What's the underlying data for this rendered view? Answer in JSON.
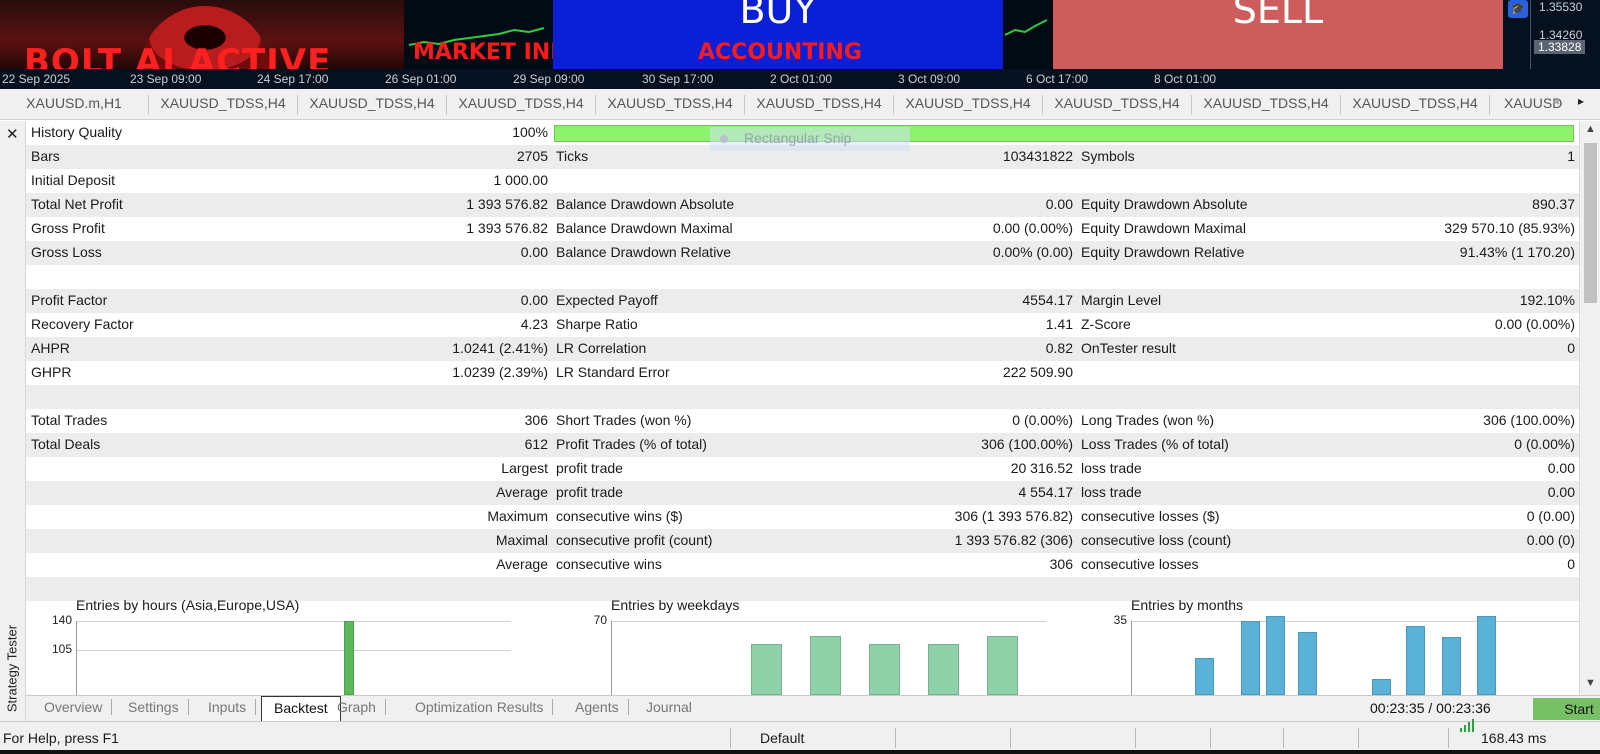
{
  "chart": {
    "banner_text": "BOLT AI ACTIVE",
    "market_info": "MARKET INFO",
    "accounting": "ACCOUNTING",
    "buy_label": "BUY",
    "sell_label": "SELL",
    "prices": [
      "1.35530",
      "1.34260"
    ],
    "current_price": "1.33828",
    "time_labels": [
      "22 Sep 2025",
      "23 Sep 09:00",
      "24 Sep 17:00",
      "26 Sep 01:00",
      "29 Sep 09:00",
      "30 Sep 17:00",
      "2 Oct 01:00",
      "3 Oct 09:00",
      "6 Oct 17:00",
      "8 Oct 01:00"
    ]
  },
  "symbol_tabs": [
    "XAUUSD.m,H1",
    "XAUUSD_TDSS,H4",
    "XAUUSD_TDSS,H4",
    "XAUUSD_TDSS,H4",
    "XAUUSD_TDSS,H4",
    "XAUUSD_TDSS,H4",
    "XAUUSD_TDSS,H4",
    "XAUUSD_TDSS,H4",
    "XAUUSD_TDSS,H4",
    "XAUUSD_TDSS,H4",
    "XAUUSD"
  ],
  "tester": {
    "side_label": "Strategy Tester",
    "history_quality": {
      "label": "History Quality",
      "value": "100%",
      "percent": 100
    },
    "rows": [
      [
        {
          "label": "Bars",
          "value": "2705"
        },
        {
          "label": "Ticks",
          "value": "103431822"
        },
        {
          "label": "Symbols",
          "value": "1"
        }
      ],
      [
        {
          "label": "Initial Deposit",
          "value": "1 000.00"
        },
        {
          "label": "",
          "value": ""
        },
        {
          "label": "",
          "value": ""
        }
      ],
      [
        {
          "label": "Total Net Profit",
          "value": "1 393 576.82"
        },
        {
          "label": "Balance Drawdown Absolute",
          "value": "0.00"
        },
        {
          "label": "Equity Drawdown Absolute",
          "value": "890.37"
        }
      ],
      [
        {
          "label": "Gross Profit",
          "value": "1 393 576.82"
        },
        {
          "label": "Balance Drawdown Maximal",
          "value": "0.00 (0.00%)"
        },
        {
          "label": "Equity Drawdown Maximal",
          "value": "329 570.10 (85.93%)"
        }
      ],
      [
        {
          "label": "Gross Loss",
          "value": "0.00"
        },
        {
          "label": "Balance Drawdown Relative",
          "value": "0.00% (0.00)"
        },
        {
          "label": "Equity Drawdown Relative",
          "value": "91.43% (1 170.20)"
        }
      ],
      [
        {
          "label": "",
          "value": ""
        },
        {
          "label": "",
          "value": ""
        },
        {
          "label": "",
          "value": ""
        }
      ],
      [
        {
          "label": "Profit Factor",
          "value": "0.00"
        },
        {
          "label": "Expected Payoff",
          "value": "4554.17"
        },
        {
          "label": "Margin Level",
          "value": "192.10%"
        }
      ],
      [
        {
          "label": "Recovery Factor",
          "value": "4.23"
        },
        {
          "label": "Sharpe Ratio",
          "value": "1.41"
        },
        {
          "label": "Z-Score",
          "value": "0.00 (0.00%)"
        }
      ],
      [
        {
          "label": "AHPR",
          "value": "1.0241 (2.41%)"
        },
        {
          "label": "LR Correlation",
          "value": "0.82"
        },
        {
          "label": "OnTester result",
          "value": "0"
        }
      ],
      [
        {
          "label": "GHPR",
          "value": "1.0239 (2.39%)"
        },
        {
          "label": "LR Standard Error",
          "value": "222 509.90"
        },
        {
          "label": "",
          "value": ""
        }
      ],
      [
        {
          "label": "",
          "value": ""
        },
        {
          "label": "",
          "value": ""
        },
        {
          "label": "",
          "value": ""
        }
      ],
      [
        {
          "label": "Total Trades",
          "value": "306"
        },
        {
          "label": "Short Trades (won %)",
          "value": "0 (0.00%)"
        },
        {
          "label": "Long Trades (won %)",
          "value": "306 (100.00%)"
        }
      ],
      [
        {
          "label": "Total Deals",
          "value": "612"
        },
        {
          "label": "Profit Trades (% of total)",
          "value": "306 (100.00%)"
        },
        {
          "label": "Loss Trades (% of total)",
          "value": "0 (0.00%)"
        }
      ]
    ],
    "trade_rows": [
      {
        "prefix": "Largest",
        "mid_label": "profit trade",
        "mid_value": "20 316.52",
        "right_label": "loss trade",
        "right_value": "0.00"
      },
      {
        "prefix": "Average",
        "mid_label": "profit trade",
        "mid_value": "4 554.17",
        "right_label": "loss trade",
        "right_value": "0.00"
      },
      {
        "prefix": "Maximum",
        "mid_label": "consecutive wins ($)",
        "mid_value": "306 (1 393 576.82)",
        "right_label": "consecutive losses ($)",
        "right_value": "0 (0.00)"
      },
      {
        "prefix": "Maximal",
        "mid_label": "consecutive profit (count)",
        "mid_value": "1 393 576.82 (306)",
        "right_label": "consecutive loss (count)",
        "right_value": "0.00 (0)"
      },
      {
        "prefix": "Average",
        "mid_label": "consecutive wins",
        "mid_value": "306",
        "right_label": "consecutive losses",
        "right_value": "0"
      }
    ],
    "snip_overlay": "Rectangular Snip"
  },
  "chart_data": [
    {
      "type": "bar",
      "title": "Entries by hours (Asia,Europe,USA)",
      "y_ticks": [
        "140",
        "105"
      ],
      "ylim": [
        70,
        140
      ],
      "values": [
        140
      ],
      "color": "#5cb85c"
    },
    {
      "type": "bar",
      "title": "Entries by weekdays",
      "y_ticks": [
        "70"
      ],
      "ylim": [
        50,
        70
      ],
      "values": [
        62,
        65,
        62,
        62,
        65
      ],
      "color": "#8fd1a8"
    },
    {
      "type": "bar",
      "title": "Entries by months",
      "y_ticks": [
        "35"
      ],
      "ylim": [
        24,
        35
      ],
      "values": [
        28,
        35,
        36,
        33,
        24,
        34,
        32,
        36
      ],
      "color": "#5ab2d6"
    }
  ],
  "bottom_tabs": [
    "Overview",
    "Settings",
    "Inputs",
    "Backtest",
    "Graph",
    "Optimization Results",
    "Agents",
    "Journal"
  ],
  "active_tab": "Backtest",
  "timer": "00:23:35 / 00:23:36",
  "start_label": "Start",
  "status": {
    "help": "For Help, press F1",
    "profile": "Default",
    "ping": "168.43 ms"
  },
  "colors": {
    "buy": "#0b1fd6",
    "sell": "#cd5c5c",
    "quality": "#8ef26f",
    "start": "#76c165"
  }
}
